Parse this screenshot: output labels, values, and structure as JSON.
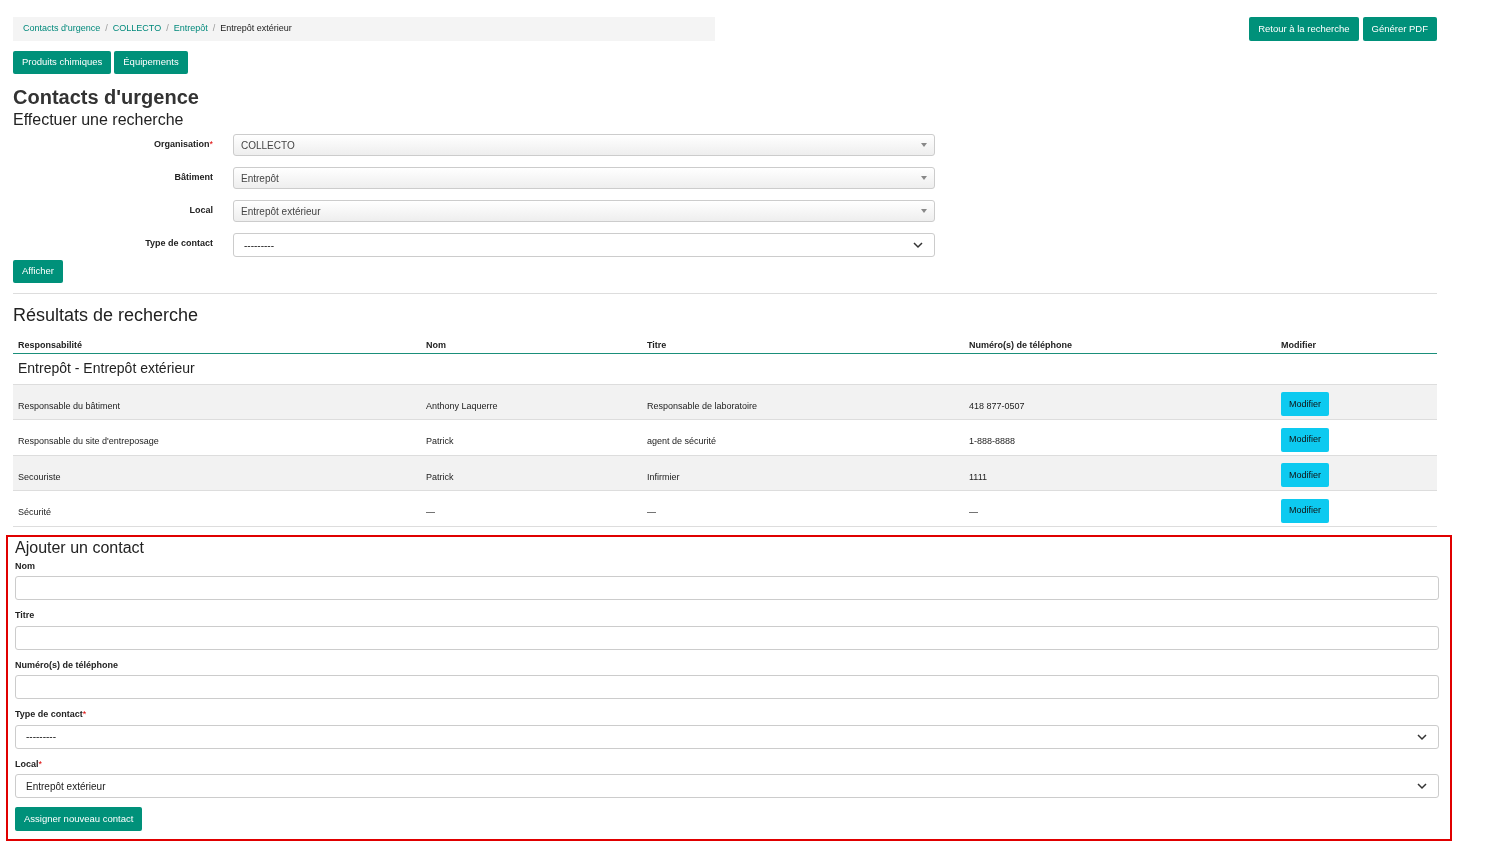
{
  "breadcrumb": [
    {
      "label": "Contacts d'urgence",
      "current": false
    },
    {
      "label": "COLLECTO",
      "current": false
    },
    {
      "label": "Entrepôt",
      "current": false
    },
    {
      "label": "Entrepôt extérieur",
      "current": true
    }
  ],
  "breadcrumb_separator": "/",
  "top_buttons": [
    "Retour à la recherche",
    "Générer PDF"
  ],
  "nav_buttons": [
    "Produits chimiques",
    "Équipements"
  ],
  "title": "Contacts d'urgence",
  "search": {
    "heading": "Effectuer une recherche",
    "fields": [
      {
        "label": "Organisation",
        "required_mark": "*",
        "kind": "legacy",
        "value": "COLLECTO"
      },
      {
        "label": "Bâtiment",
        "kind": "legacy",
        "value": "Entrepôt"
      },
      {
        "label": "Local",
        "kind": "legacy",
        "value": "Entrepôt extérieur"
      },
      {
        "label": "Type de contact",
        "kind": "select",
        "value": "---------"
      }
    ],
    "button": "Afficher"
  },
  "results": {
    "heading": "Résultats de recherche",
    "columns": [
      "Responsabilité",
      "Nom",
      "Titre",
      "Numéro(s) de téléphone",
      "Modifier"
    ],
    "group": "Entrepôt - Entrepôt extérieur",
    "rows": [
      {
        "cells": [
          "Responsable du bâtiment",
          "Anthony Laquerre",
          "Responsable de laboratoire",
          "418 877-0507"
        ],
        "button": "Modifier"
      },
      {
        "cells": [
          "Responsable du site d'entreposage",
          "Patrick",
          "agent de sécurité",
          "1-888-8888"
        ],
        "button": "Modifier"
      },
      {
        "cells": [
          "Secouriste",
          "Patrick",
          "Infirmier",
          "1111"
        ],
        "button": "Modifier"
      },
      {
        "cells": [
          "Sécurité",
          "—",
          "—",
          "—"
        ],
        "button": "Modifier"
      }
    ]
  },
  "add_contact": {
    "heading": "Ajouter un contact",
    "highlighted": true,
    "fields": [
      {
        "label": "Nom",
        "kind": "text"
      },
      {
        "label": "Titre",
        "kind": "text"
      },
      {
        "label": "Numéro(s) de téléphone",
        "kind": "text"
      },
      {
        "label": "Type de contact",
        "required_mark": "*",
        "kind": "select",
        "value": "---------"
      },
      {
        "label": "Local",
        "required_mark": "*",
        "kind": "select",
        "value": "Entrepôt extérieur"
      }
    ],
    "button": "Assigner nouveau contact"
  }
}
